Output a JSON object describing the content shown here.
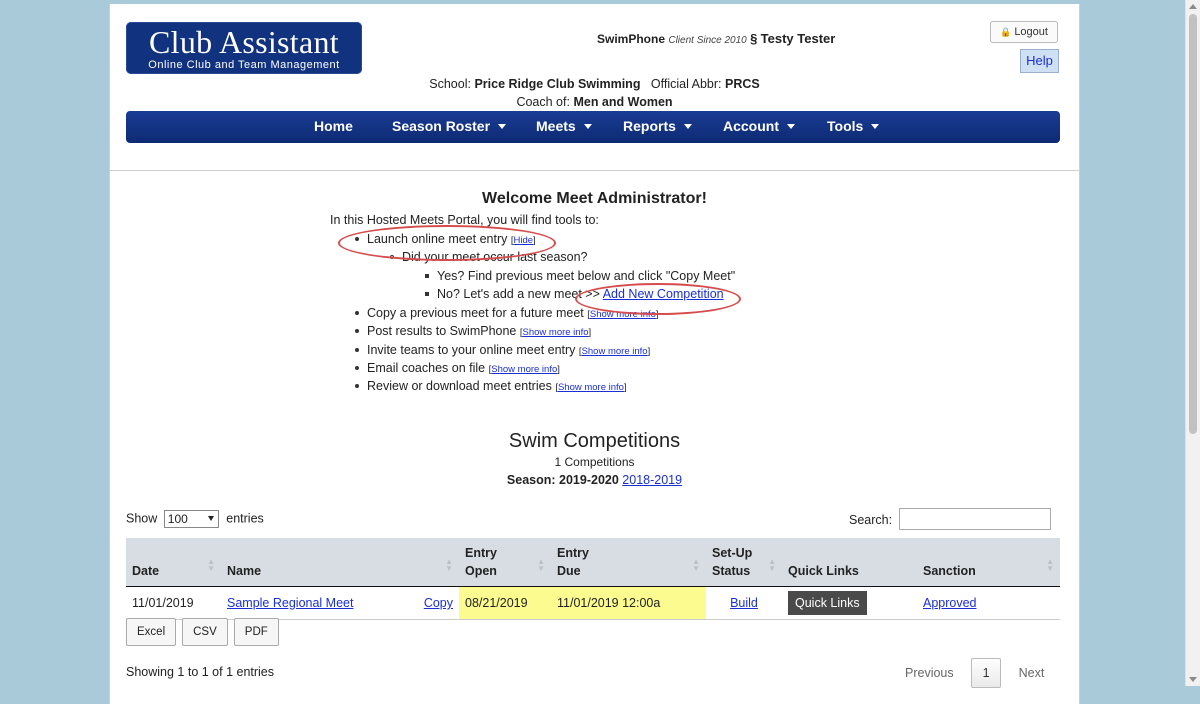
{
  "header": {
    "logo_title": "Club Assistant",
    "logo_subtitle": "Online Club and Team Management",
    "product": "SwimPhone",
    "client_since": "Client Since 2010",
    "section_mark": "§",
    "user_name": "Testy Tester",
    "logout_label": "Logout",
    "help_label": "Help",
    "school_label": "School:",
    "school_name": "Price Ridge Club Swimming",
    "abbr_label": "Official Abbr:",
    "abbr_value": "PRCS",
    "coach_label": "Coach of:",
    "coach_value": "Men and Women"
  },
  "nav": {
    "items": [
      {
        "label": "Home"
      },
      {
        "label": "Season Roster"
      },
      {
        "label": "Meets"
      },
      {
        "label": "Reports"
      },
      {
        "label": "Account"
      },
      {
        "label": "Tools"
      }
    ]
  },
  "welcome": {
    "title": "Welcome Meet Administrator!",
    "intro": "In this Hosted Meets Portal, you will find tools to:",
    "launch": "Launch online meet entry",
    "hide_link": "Hide",
    "did_occur": "Did your meet occur last season?",
    "yes_text": "Yes? Find previous meet below and click \"Copy Meet\"",
    "no_text": "No? Let's add a new meet >>",
    "add_new_link": "Add New Competition",
    "copy_prev": "Copy a previous meet for a future meet",
    "post_results": "Post results to SwimPhone",
    "invite": "Invite teams to your online meet entry",
    "email": "Email coaches on file",
    "review": "Review or download meet entries",
    "show_more": "Show more info"
  },
  "competitions": {
    "title": "Swim Competitions",
    "count": "1 Competitions",
    "season_label": "Season: 2019-2020",
    "prev_season_link": "2018-2019"
  },
  "table_controls": {
    "show_label": "Show",
    "show_value": "100",
    "entries_label": "entries",
    "search_label": "Search:"
  },
  "table": {
    "headers": {
      "date": "Date",
      "name": "Name",
      "entry_open_1": "Entry",
      "entry_open_2": "Open",
      "entry_due_1": "Entry",
      "entry_due_2": "Due",
      "setup_1": "Set-Up",
      "setup_2": "Status",
      "quick_links": "Quick Links",
      "sanction": "Sanction"
    },
    "rows": [
      {
        "date": "11/01/2019",
        "name": "Sample Regional Meet",
        "copy": "Copy",
        "entry_open": "08/21/2019",
        "entry_due": "11/01/2019 12:00a",
        "setup": "Build",
        "quick_links": "Quick Links",
        "sanction": "Approved"
      }
    ]
  },
  "export": {
    "excel": "Excel",
    "csv": "CSV",
    "pdf": "PDF"
  },
  "footer": {
    "showing": "Showing 1 to 1 of 1 entries",
    "previous": "Previous",
    "page": "1",
    "next": "Next"
  },
  "colors": {
    "nav_blue": "#11327e",
    "highlight_yellow": "#fbfb8f",
    "annotation_red": "#d64c4c",
    "page_bg": "#a9cad8"
  }
}
